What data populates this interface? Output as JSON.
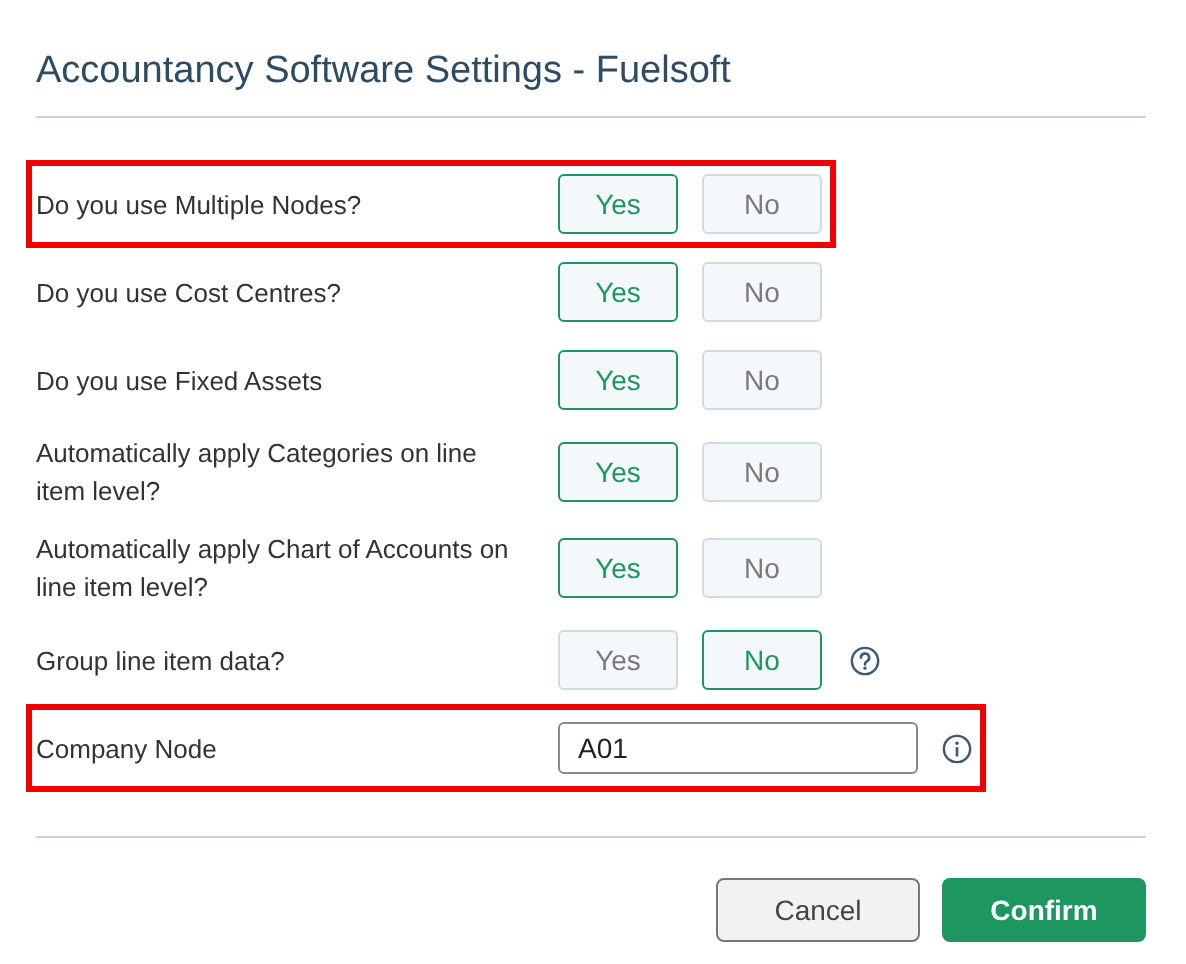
{
  "dialog": {
    "title": "Accountancy Software Settings - Fuelsoft"
  },
  "settings": [
    {
      "kind": "toggle",
      "label": "Do you use Multiple Nodes?",
      "highlighted": true,
      "help": false,
      "options": [
        {
          "label": "Yes",
          "selected": true
        },
        {
          "label": "No",
          "selected": false
        }
      ]
    },
    {
      "kind": "toggle",
      "label": "Do you use Cost Centres?",
      "highlighted": false,
      "help": false,
      "options": [
        {
          "label": "Yes",
          "selected": true
        },
        {
          "label": "No",
          "selected": false
        }
      ]
    },
    {
      "kind": "toggle",
      "label": "Do you use Fixed Assets",
      "highlighted": false,
      "help": false,
      "options": [
        {
          "label": "Yes",
          "selected": true
        },
        {
          "label": "No",
          "selected": false
        }
      ]
    },
    {
      "kind": "toggle",
      "label": "Automatically apply Categories on line item level?",
      "highlighted": false,
      "help": false,
      "options": [
        {
          "label": "Yes",
          "selected": true
        },
        {
          "label": "No",
          "selected": false
        }
      ]
    },
    {
      "kind": "toggle",
      "label": "Automatically apply Chart of Accounts on line item level?",
      "highlighted": false,
      "help": false,
      "options": [
        {
          "label": "Yes",
          "selected": true
        },
        {
          "label": "No",
          "selected": false
        }
      ]
    },
    {
      "kind": "toggle",
      "label": "Group line item data?",
      "highlighted": false,
      "help": true,
      "options": [
        {
          "label": "Yes",
          "selected": false
        },
        {
          "label": "No",
          "selected": true
        }
      ]
    },
    {
      "kind": "text",
      "label": "Company Node",
      "highlighted": true,
      "help": true,
      "value": "A01"
    }
  ],
  "buttons": [
    {
      "label": "Cancel",
      "kind": "secondary"
    },
    {
      "label": "Confirm",
      "kind": "primary"
    }
  ]
}
